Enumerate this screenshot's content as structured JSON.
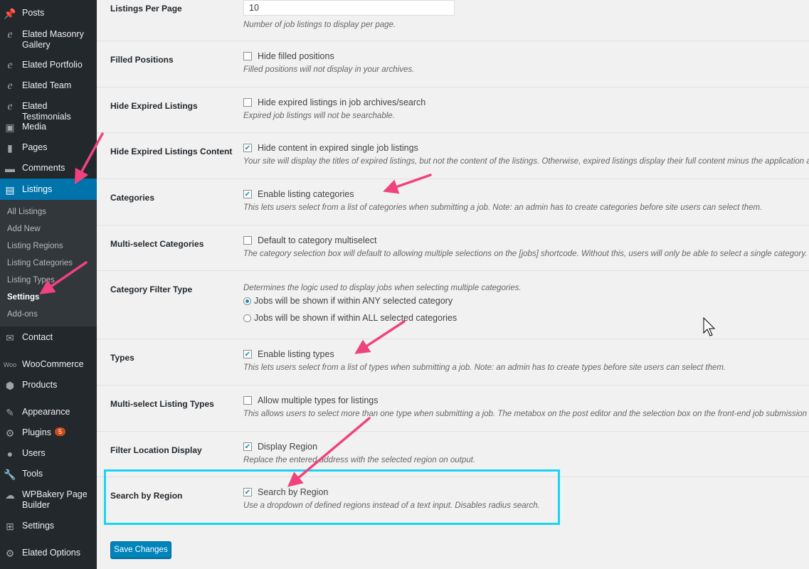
{
  "sidebar": {
    "items": [
      {
        "label": "Posts",
        "icon": "pin-icon"
      },
      {
        "label": "Elated Masonry Gallery",
        "icon": "elated-icon"
      },
      {
        "label": "Elated Portfolio",
        "icon": "elated-icon"
      },
      {
        "label": "Elated Team",
        "icon": "elated-icon"
      },
      {
        "label": "Elated Testimonials",
        "icon": "elated-icon"
      },
      {
        "label": "Media",
        "icon": "media-icon"
      },
      {
        "label": "Pages",
        "icon": "pages-icon"
      },
      {
        "label": "Comments",
        "icon": "comments-icon"
      },
      {
        "label": "Listings",
        "icon": "briefcase-icon",
        "active": true
      },
      {
        "label": "Contact",
        "icon": "envelope-icon"
      },
      {
        "label": "WooCommerce",
        "icon": "woocommerce-icon"
      },
      {
        "label": "Products",
        "icon": "products-icon"
      },
      {
        "label": "Appearance",
        "icon": "brush-icon"
      },
      {
        "label": "Plugins",
        "icon": "plugins-icon",
        "badge": "5"
      },
      {
        "label": "Users",
        "icon": "users-icon"
      },
      {
        "label": "Tools",
        "icon": "wrench-icon"
      },
      {
        "label": "WPBakery Page Builder",
        "icon": "wpbakery-icon"
      },
      {
        "label": "Settings",
        "icon": "settings-icon"
      },
      {
        "label": "Elated Options",
        "icon": "gear-icon"
      }
    ],
    "submenu": [
      "All Listings",
      "Add New",
      "Listing Regions",
      "Listing Categories",
      "Listing Types",
      "Settings",
      "Add-ons"
    ],
    "submenu_current": "Settings",
    "colors": {
      "bg": "#23282d",
      "active": "#0073aa",
      "submenu_bg": "#32373c"
    }
  },
  "settings": {
    "listings_per_page": {
      "label": "Listings Per Page",
      "value": "10",
      "desc": "Number of job listings to display per page."
    },
    "filled_positions": {
      "label": "Filled Positions",
      "checkbox": "Hide filled positions",
      "checked": false,
      "desc": "Filled positions will not display in your archives."
    },
    "hide_expired": {
      "label": "Hide Expired Listings",
      "checkbox": "Hide expired listings in job archives/search",
      "checked": false,
      "desc": "Expired job listings will not be searchable."
    },
    "hide_expired_content": {
      "label": "Hide Expired Listings Content",
      "checkbox": "Hide content in expired single job listings",
      "checked": true,
      "desc": "Your site will display the titles of expired listings, but not the content of the listings. Otherwise, expired listings display their full content minus the application area."
    },
    "categories": {
      "label": "Categories",
      "checkbox": "Enable listing categories",
      "checked": true,
      "desc": "This lets users select from a list of categories when submitting a job. Note: an admin has to create categories before site users can select them."
    },
    "multi_categories": {
      "label": "Multi-select Categories",
      "checkbox": "Default to category multiselect",
      "checked": false,
      "desc": "The category selection box will default to allowing multiple selections on the [jobs] shortcode. Without this, users will only be able to select a single category."
    },
    "category_filter": {
      "label": "Category Filter Type",
      "desc": "Determines the logic used to display jobs when selecting multiple categories.",
      "option_any": "Jobs will be shown if within ANY selected category",
      "option_all": "Jobs will be shown if within ALL selected categories",
      "selected": "any"
    },
    "types": {
      "label": "Types",
      "checkbox": "Enable listing types",
      "checked": true,
      "desc": "This lets users select from a list of types when submitting a job. Note: an admin has to create types before site users can select them."
    },
    "multi_types": {
      "label": "Multi-select Listing Types",
      "checkbox": "Allow multiple types for listings",
      "checked": false,
      "desc": "This allows users to select more than one type when submitting a job. The metabox on the post editor and the selection box on the front-end job submission form will reflect this."
    },
    "filter_location": {
      "label": "Filter Location Display",
      "checkbox": "Display Region",
      "checked": true,
      "desc": "Replace the entered address with the selected region on output."
    },
    "search_region": {
      "label": "Search by Region",
      "checkbox": "Search by Region",
      "checked": true,
      "desc": "Use a dropdown of defined regions instead of a text input. Disables radius search."
    }
  },
  "save_label": "Save Changes",
  "colors": {
    "accent": "#0085ba",
    "highlight": "#1ad4f5",
    "annotation_arrow": "#f0437e",
    "checkmark": "#1e8cbe"
  }
}
